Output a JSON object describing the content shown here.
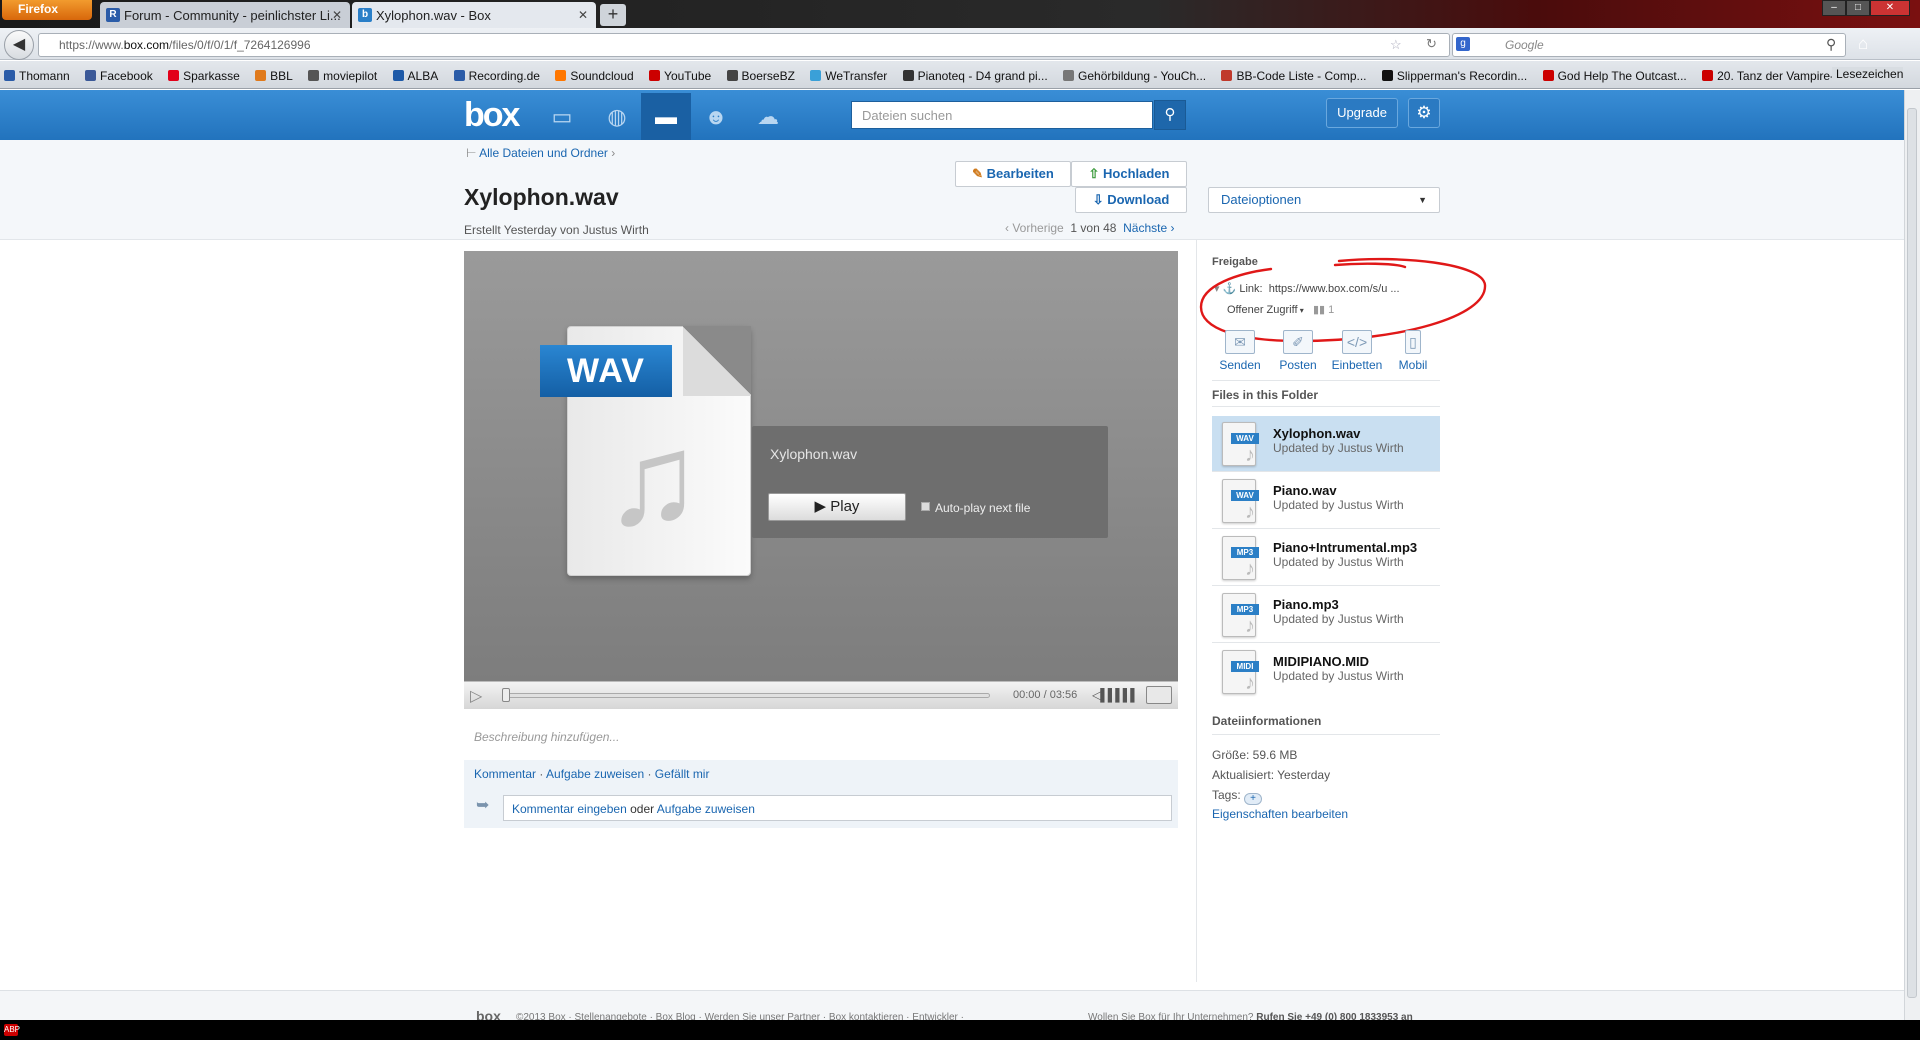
{
  "browser": {
    "menu_label": "Firefox",
    "tabs": [
      {
        "label": "Forum - Community - peinlichster Li..."
      },
      {
        "label": "Xylophon.wav - Box"
      }
    ],
    "new_tab": "+",
    "url_prefix": "https://www.",
    "url_host": "box.com",
    "url_path": "/files/0/f/0/1/f_7264126996",
    "search_placeholder": "Google",
    "bookmarks": [
      {
        "label": "Thomann",
        "color": "#2b5ca8"
      },
      {
        "label": "Facebook",
        "color": "#3b5998"
      },
      {
        "label": "Sparkasse",
        "color": "#e2001a"
      },
      {
        "label": "BBL",
        "color": "#e07a1c"
      },
      {
        "label": "moviepilot",
        "color": "#555555"
      },
      {
        "label": "ALBA",
        "color": "#1e5aa8"
      },
      {
        "label": "Recording.de",
        "color": "#2b5ca8"
      },
      {
        "label": "Soundcloud",
        "color": "#ff7700"
      },
      {
        "label": "YouTube",
        "color": "#cc0000"
      },
      {
        "label": "BoerseBZ",
        "color": "#444444"
      },
      {
        "label": "WeTransfer",
        "color": "#3aa0d8"
      },
      {
        "label": "Pianoteq - D4 grand pi...",
        "color": "#333333"
      },
      {
        "label": "Gehörbildung - YouCh...",
        "color": "#777777"
      },
      {
        "label": "BB-Code Liste - Comp...",
        "color": "#c0392b"
      },
      {
        "label": "Slipperman's Recordin...",
        "color": "#111111"
      },
      {
        "label": "God Help The Outcast...",
        "color": "#cc0000"
      },
      {
        "label": "20. Tanz der Vampire- ...",
        "color": "#cc0000"
      }
    ],
    "bookmarks_menu": "Lesezeichen"
  },
  "box": {
    "logo": "box",
    "search_placeholder": "Dateien suchen",
    "upgrade_label": "Upgrade",
    "breadcrumb": "Alle Dateien und Ordner",
    "file_title": "Xylophon.wav",
    "created": "Erstellt Yesterday von Justus Wirth",
    "edit_label": "Bearbeiten",
    "upload_label": "Hochladen",
    "download_label": "Download",
    "file_options_label": "Dateioptionen",
    "pager": {
      "prev": "Vorherige",
      "position": "1 von 48",
      "next": "Nächste"
    }
  },
  "player": {
    "badge": "WAV",
    "audio_name": "Xylophon.wav",
    "play_label": "Play",
    "autoplay_label": "Auto-play next file",
    "time": "00:00 / 03:56",
    "progress": 0
  },
  "description_placeholder": "Beschreibung hinzufügen...",
  "comments": {
    "comment": "Kommentar",
    "assign": "Aufgabe zuweisen",
    "like": "Gefällt mir",
    "input_link1": "Kommentar eingeben",
    "input_or": "oder",
    "input_link2": "Aufgabe zuweisen"
  },
  "sharing": {
    "heading": "Freigabe",
    "link_label": "Link:",
    "link_url": "https://www.box.com/s/u ...",
    "access": "Offener Zugriff",
    "access_count": "1",
    "actions": [
      {
        "label": "Senden",
        "icon": "envelope-icon"
      },
      {
        "label": "Posten",
        "icon": "post-icon"
      },
      {
        "label": "Einbetten",
        "icon": "embed-icon"
      },
      {
        "label": "Mobil",
        "icon": "mobile-icon"
      }
    ]
  },
  "folder_files": {
    "heading": "Files in this Folder",
    "items": [
      {
        "name": "Xylophon.wav",
        "sub": "Updated by Justus Wirth",
        "tag": "WAV"
      },
      {
        "name": "Piano.wav",
        "sub": "Updated by Justus Wirth",
        "tag": "WAV"
      },
      {
        "name": "Piano+Intrumental.mp3",
        "sub": "Updated by Justus Wirth",
        "tag": "MP3"
      },
      {
        "name": "Piano.mp3",
        "sub": "Updated by Justus Wirth",
        "tag": "MP3"
      },
      {
        "name": "MIDIPIANO.MID",
        "sub": "Updated by Justus Wirth",
        "tag": "MIDI"
      }
    ]
  },
  "file_info": {
    "heading": "Dateiinformationen",
    "size": "Größe: 59.6 MB",
    "updated": "Aktualisiert: Yesterday",
    "tags": "Tags:",
    "tag_add": "+",
    "edit_props": "Eigenschaften bearbeiten"
  },
  "footer": {
    "logo": "box",
    "links": "©2013 Box  ·  Stellenangebote  ·  Box Blog  ·  Werden Sie unser Partner  ·  Box kontaktieren  ·  Entwickler  ·",
    "right_text": "Wollen Sie Box für Ihr Unternehmen?",
    "right_phone": "Rufen Sie +49 (0) 800 1833953 an"
  },
  "colors": {
    "brand": "#2a7fc8",
    "link": "#1a66b0",
    "annotation": "#e01818"
  }
}
